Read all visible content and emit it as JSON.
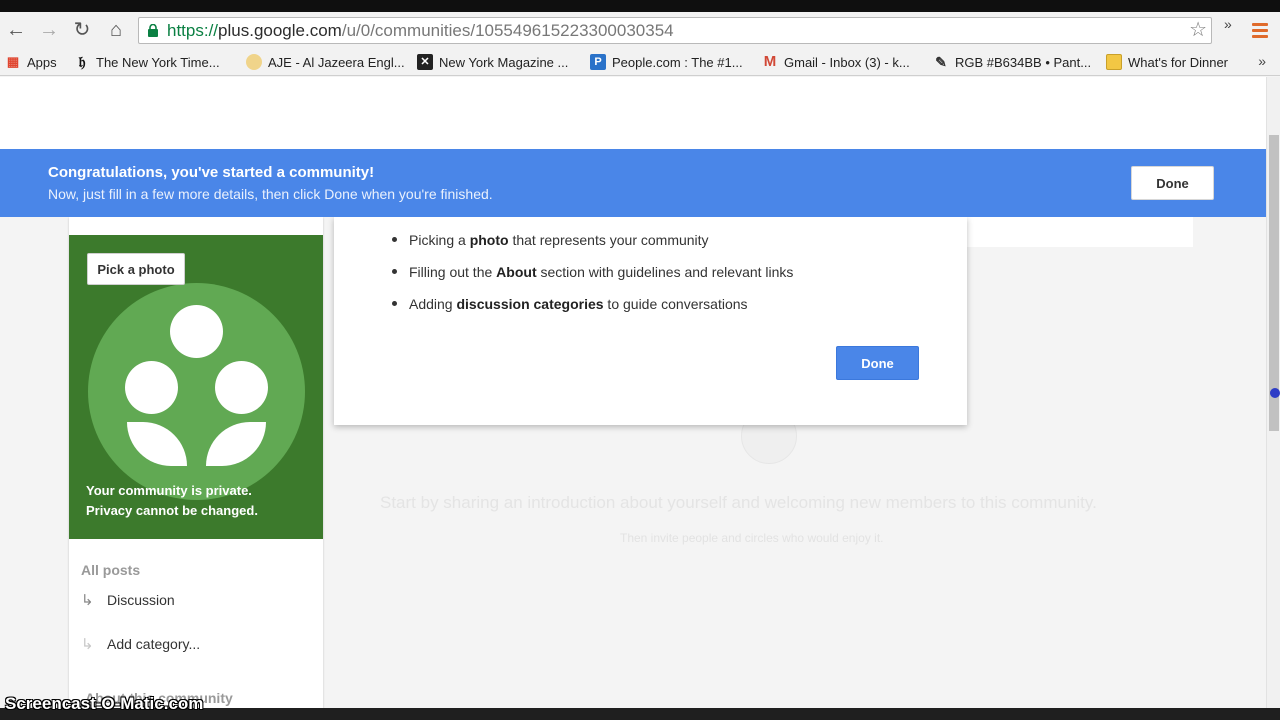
{
  "browser": {
    "url_scheme": "https://",
    "url_host": "plus.google.com",
    "url_path": "/u/0/communities/105549615223300030354",
    "bookmarks": [
      {
        "label": "Apps",
        "icon": "apps-grid-icon",
        "color": "#e0452f"
      },
      {
        "label": "The New York Time...",
        "icon": "nyt-icon",
        "color": "#111111"
      },
      {
        "label": "AJE - Al Jazeera Engl...",
        "icon": "aljazeera-icon",
        "color": "#d9a52b"
      },
      {
        "label": "New York Magazine ...",
        "icon": "nymag-icon",
        "color": "#222222"
      },
      {
        "label": "People.com : The #1...",
        "icon": "people-icon",
        "color": "#2a72c9"
      },
      {
        "label": "Gmail - Inbox (3) - k...",
        "icon": "gmail-icon",
        "color": "#d14836"
      },
      {
        "label": "RGB #B634BB • Pant...",
        "icon": "pantone-icon",
        "color": "#333333"
      },
      {
        "label": "What's for Dinner",
        "icon": "folder-icon",
        "color": "#f2c744"
      }
    ]
  },
  "banner": {
    "title": "Congratulations, you've started a community!",
    "subtitle": "Now, just fill in a few more details, then click Done when you're finished.",
    "done_label": "Done",
    "color": "#4a86e8"
  },
  "community_card": {
    "pick_photo_label": "Pick a photo",
    "privacy_line1": "Your community is private.",
    "privacy_line2": "Privacy cannot be changed.",
    "green": "#3c7a2c"
  },
  "sidebar": {
    "all_posts": "All posts",
    "categories": [
      {
        "label": "Discussion"
      },
      {
        "label": "Add category..."
      }
    ],
    "about": "About this community"
  },
  "dialog": {
    "items": [
      {
        "before": "Picking a ",
        "bold": "photo",
        "after": " that represents your community"
      },
      {
        "before": "Filling out the ",
        "bold": "About",
        "after": " section with guidelines and relevant links"
      },
      {
        "before": "Adding ",
        "bold": "discussion categories",
        "after": " to guide conversations"
      }
    ],
    "done_label": "Done"
  },
  "background": {
    "intro_text": "Start by sharing an introduction about yourself and welcoming new members to this community.",
    "invite_text": "Then invite people and circles who would enjoy it."
  },
  "watermark": "Screencast-O-Matic.com"
}
